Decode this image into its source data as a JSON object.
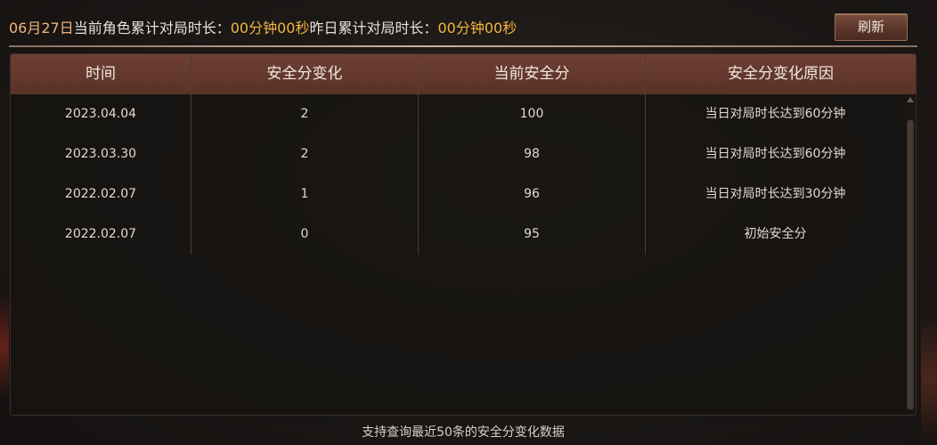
{
  "header": {
    "date": "06月27日",
    "current_label": "当前角色累计对局时长：",
    "current_value": "00分钟00秒",
    "yesterday_label": "昨日累计对局时长：",
    "yesterday_value": "00分钟00秒",
    "refresh_label": "刷新"
  },
  "table": {
    "columns": [
      "时间",
      "安全分变化",
      "当前安全分",
      "安全分变化原因"
    ],
    "rows": [
      {
        "time": "2023.04.04",
        "change": "2",
        "score": "100",
        "reason": "当日对局时长达到60分钟"
      },
      {
        "time": "2023.03.30",
        "change": "2",
        "score": "98",
        "reason": "当日对局时长达到60分钟"
      },
      {
        "time": "2022.02.07",
        "change": "1",
        "score": "96",
        "reason": "当日对局时长达到30分钟"
      },
      {
        "time": "2022.02.07",
        "change": "0",
        "score": "95",
        "reason": "初始安全分"
      }
    ]
  },
  "footer": {
    "note": "支持查询最近50条的安全分变化数据"
  },
  "colors": {
    "accent_date": "#f0b47a",
    "accent_value": "#f3b53f",
    "header_bg": "#6e3f33"
  }
}
